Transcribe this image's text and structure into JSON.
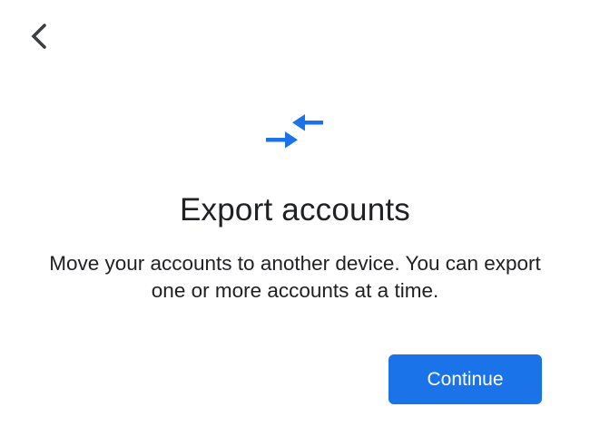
{
  "header": {
    "back_icon": "chevron-left-icon"
  },
  "hero": {
    "icon": "swap-arrows-icon",
    "icon_color": "#1a73e8"
  },
  "content": {
    "title": "Export accounts",
    "description": "Move your accounts to another device. You can export one or more accounts at a time."
  },
  "actions": {
    "continue_label": "Continue",
    "accent_color": "#1a73e8"
  }
}
